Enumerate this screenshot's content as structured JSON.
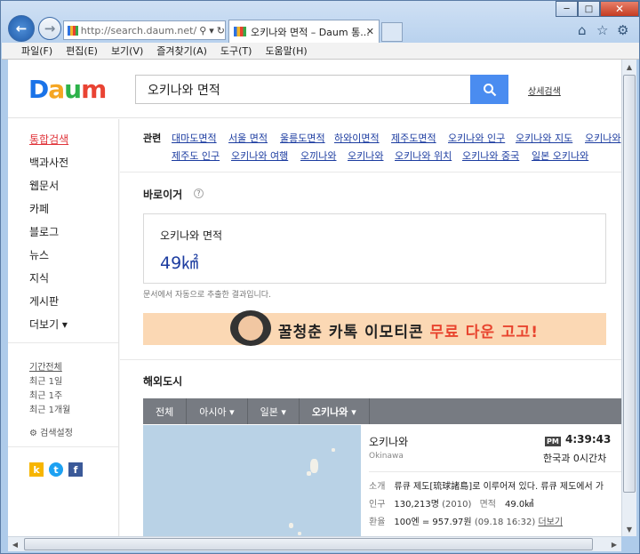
{
  "browser": {
    "address": "http://search.daum.net/",
    "tab_title": "오키나와 면적 – Daum 통...",
    "menu": [
      "파일(F)",
      "편집(E)",
      "보기(V)",
      "즐겨찾기(A)",
      "도구(T)",
      "도움말(H)"
    ],
    "minimize": "─",
    "maximize": "□",
    "close": "✕"
  },
  "header": {
    "logo": [
      "D",
      "a",
      "u",
      "m"
    ],
    "query": "오키나와 면적",
    "advanced_search": "상세검색"
  },
  "sidebar": {
    "items": [
      "통합검색",
      "백과사전",
      "웹문서",
      "카페",
      "블로그",
      "뉴스",
      "지식",
      "게시판",
      "더보기 ▾"
    ],
    "filters": [
      "기간전체",
      "최근 1일",
      "최근 1주",
      "최근 1개월"
    ],
    "settings": "검색설정",
    "social_icons": [
      "kakaostory-icon",
      "twitter-icon",
      "facebook-icon"
    ],
    "social_colors": [
      "#f7b500",
      "#1da1f2",
      "#3b5998"
    ]
  },
  "related": {
    "label": "관련",
    "row1": [
      "대마도면적",
      "서울 면적",
      "울릉도면적",
      "하와이면적",
      "제주도면적",
      "오키나와 인구",
      "오키나와 지도",
      "오키나와"
    ],
    "row2": [
      "제주도 인구",
      "오키나와 여행",
      "오끼나와",
      "오키나와",
      "오키나와 위치",
      "오키나와 중국",
      "일본 오키나와"
    ]
  },
  "answer": {
    "section_title": "바로이거",
    "help": "?",
    "label": "오키나와 면적",
    "value": "49㎢",
    "note": "문서에서 자동으로 추출한 결과입니다."
  },
  "banner": {
    "text_before": "꿀청춘 카톡 이모티콘 ",
    "text_highlight": "무료 다운 고고!"
  },
  "city": {
    "section_title": "해외도시",
    "nav": [
      "전체",
      "아시아 ▾",
      "일본 ▾",
      "오키나와 ▾"
    ],
    "name": "오키나와",
    "name_en": "Okinawa",
    "ampm": "PM",
    "time": "4:39:43",
    "time_diff": "한국과 0시간차",
    "intro_label": "소개",
    "intro": "류큐 제도[琉球諸島]로 이루어져 있다. 류큐 제도에서 가",
    "pop_label": "인구",
    "pop": "130,213명",
    "pop_year": "(2010)",
    "area_label": "면적",
    "area": "49.0㎢",
    "fx_label": "환율",
    "fx": "100엔 = 957.97원",
    "fx_date": "(09.18 16:32)",
    "fx_more": "더보기"
  }
}
